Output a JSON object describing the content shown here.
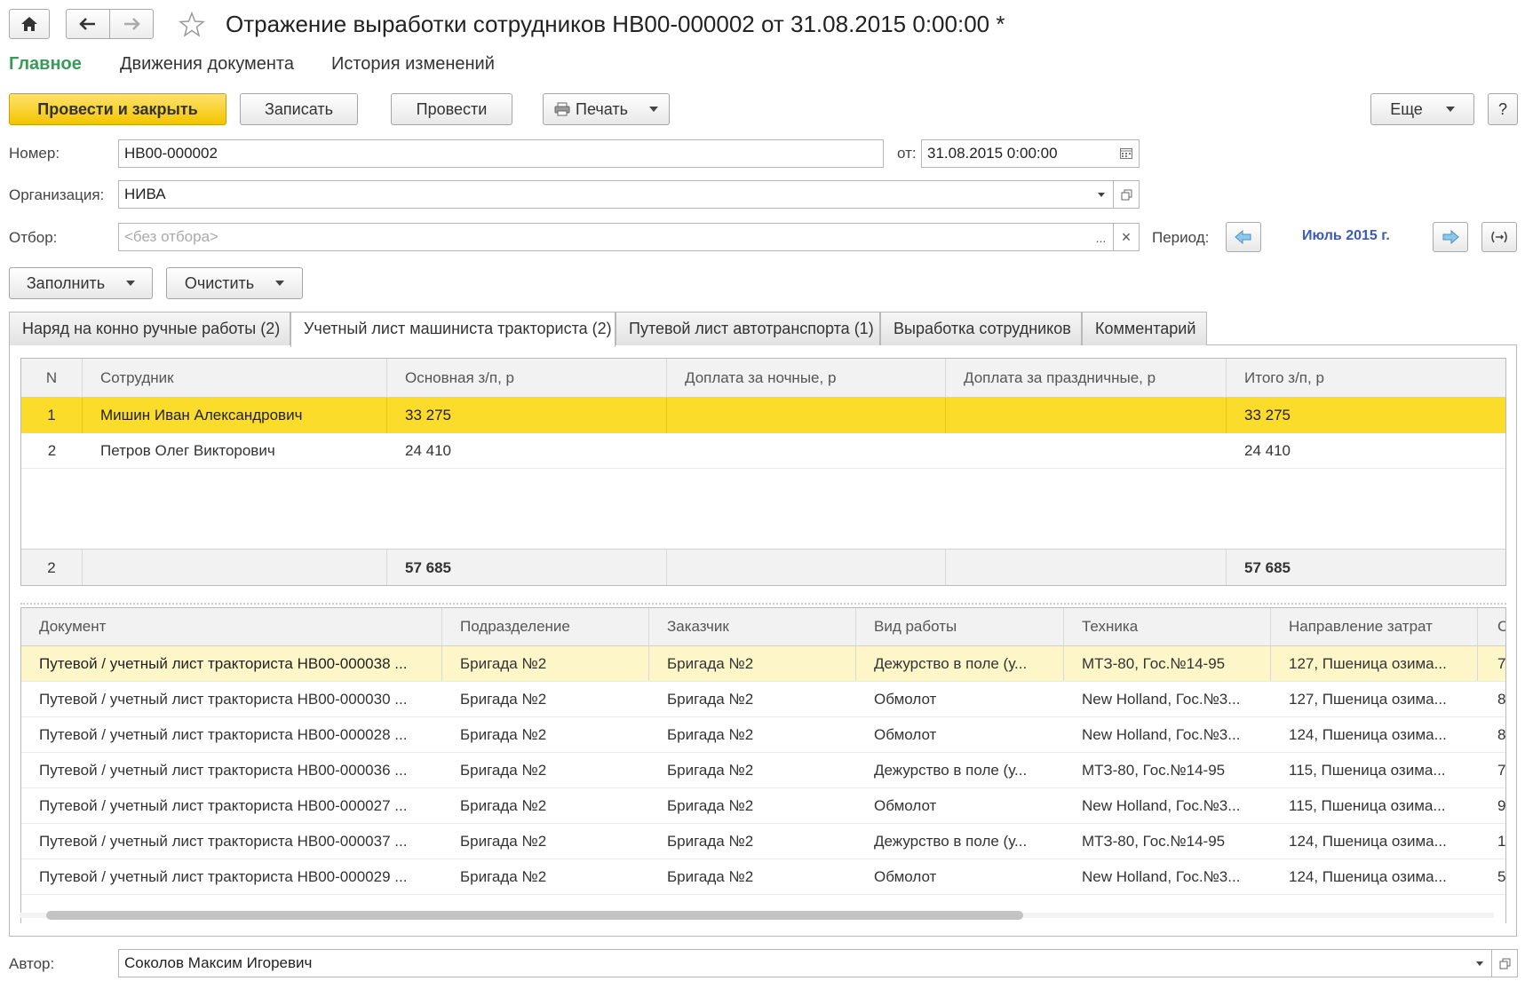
{
  "window": {
    "title": "Отражение выработки сотрудников НВ00-000002 от 31.08.2015 0:00:00 *"
  },
  "top_tabs": [
    {
      "label": "Главное",
      "active": true
    },
    {
      "label": "Движения документа",
      "active": false
    },
    {
      "label": "История изменений",
      "active": false
    }
  ],
  "toolbar": {
    "post_close": "Провести и закрыть",
    "save": "Записать",
    "post": "Провести",
    "print": "Печать",
    "more": "Еще",
    "help": "?"
  },
  "form": {
    "number_label": "Номер:",
    "number_value": "НВ00-000002",
    "date_label": "от:",
    "date_value": "31.08.2015  0:00:00",
    "org_label": "Организация:",
    "org_value": "НИВА",
    "filter_label": "Отбор:",
    "filter_placeholder": "<без отбора>",
    "filter_more": "...",
    "filter_clear": "×",
    "period_label": "Период:",
    "period_value": "Июль 2015 г."
  },
  "fill_buttons": {
    "fill": "Заполнить",
    "clear": "Очистить"
  },
  "content_tabs": [
    {
      "label": "Наряд на конно ручные работы (2)",
      "active": false
    },
    {
      "label": "Учетный лист машиниста тракториста (2)",
      "active": true
    },
    {
      "label": "Путевой лист автотранспорта (1)",
      "active": false
    },
    {
      "label": "Выработка сотрудников",
      "active": false
    },
    {
      "label": "Комментарий",
      "active": false
    }
  ],
  "employees_table": {
    "headers": [
      "N",
      "Сотрудник",
      "Основная з/п, р",
      "Доплата за ночные, р",
      "Доплата за праздничные, р",
      "Итого з/п, р"
    ],
    "rows": [
      [
        "1",
        "Мишин Иван Александрович",
        "33 275",
        "",
        "",
        "33 275"
      ],
      [
        "2",
        "Петров Олег Викторович",
        "24 410",
        "",
        "",
        "24 410"
      ]
    ],
    "footer": [
      "2",
      "",
      "57 685",
      "",
      "",
      "57 685"
    ]
  },
  "docs_table": {
    "headers": [
      "Документ",
      "Подразделение",
      "Заказчик",
      "Вид работы",
      "Техника",
      "Направление затрат",
      "С"
    ],
    "rows": [
      [
        "Путевой / учетный лист тракториста НВ00-000038 ...",
        "Бригада №2",
        "Бригада №2",
        "Дежурство в поле (у...",
        "МТЗ-80, Гос.№14-95",
        "127, Пшеница озима...",
        "7"
      ],
      [
        "Путевой / учетный лист тракториста НВ00-000030 ...",
        "Бригада №2",
        "Бригада №2",
        "Обмолот",
        "New Holland, Гос.№3...",
        "127, Пшеница озима...",
        "8"
      ],
      [
        "Путевой / учетный лист тракториста НВ00-000028 ...",
        "Бригада №2",
        "Бригада №2",
        "Обмолот",
        "New Holland, Гос.№3...",
        "124, Пшеница озима...",
        "8"
      ],
      [
        "Путевой / учетный лист тракториста НВ00-000036 ...",
        "Бригада №2",
        "Бригада №2",
        "Дежурство в поле (у...",
        "МТЗ-80, Гос.№14-95",
        "115, Пшеница озима...",
        "7"
      ],
      [
        "Путевой / учетный лист тракториста НВ00-000027 ...",
        "Бригада №2",
        "Бригада №2",
        "Обмолот",
        "New Holland, Гос.№3...",
        "115, Пшеница озима...",
        "9"
      ],
      [
        "Путевой / учетный лист тракториста НВ00-000037 ...",
        "Бригада №2",
        "Бригада №2",
        "Дежурство в поле (у...",
        "МТЗ-80, Гос.№14-95",
        "124, Пшеница озима...",
        "1"
      ],
      [
        "Путевой / учетный лист тракториста НВ00-000029 ...",
        "Бригада №2",
        "Бригада №2",
        "Обмолот",
        "New Holland, Гос.№3...",
        "124, Пшеница озима...",
        "5"
      ]
    ]
  },
  "author": {
    "label": "Автор:",
    "value": "Соколов Максим Игоревич"
  },
  "colors": {
    "accent_green": "#3a9a5a",
    "primary_yellow": "#f4c400",
    "selection_yellow": "#fbdc2b",
    "period_blue": "#3b5bb5"
  }
}
